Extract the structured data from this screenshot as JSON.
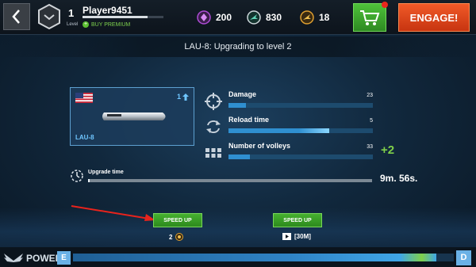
{
  "topbar": {
    "level": "1",
    "level_label": "Level",
    "player_name": "Player9451",
    "xp_progress": 0.8,
    "buy_premium": "BUY PREMIUM",
    "currencies": [
      {
        "name": "platinum",
        "icon": "diamond-icon",
        "color": "#b04cd8",
        "value": "200"
      },
      {
        "name": "credits",
        "icon": "plane-coin-icon",
        "color": "#3fb8a0",
        "value": "830"
      },
      {
        "name": "gold",
        "icon": "medal-coin-icon",
        "color": "#e0a030",
        "value": "18"
      }
    ],
    "engage_label": "ENGAGE!"
  },
  "subtitle": "LAU-8: Upgrading to level 2",
  "weapon": {
    "name": "LAU-8",
    "upgrades": "1",
    "flag": "us-flag-icon"
  },
  "stats": [
    {
      "label": "Damage",
      "value": "23",
      "progress": 0.12,
      "icon": "crosshair-icon"
    },
    {
      "label": "Reload time",
      "value": "5",
      "progress": 0.7,
      "icon": "reload-icon"
    },
    {
      "label": "Number of volleys",
      "value": "33",
      "progress": 0.15,
      "icon": "volleys-icon"
    }
  ],
  "volley_bonus": "+2",
  "upgrade_time": {
    "label": "Upgrade time",
    "remaining": "9m. 56s.",
    "progress": 0.005
  },
  "actions": [
    {
      "label": "SPEED UP",
      "cost": "2",
      "cost_icon": "gold-coin-icon"
    },
    {
      "label": "SPEED UP",
      "cost": "[30M]",
      "cost_icon": "video-ad-icon"
    }
  ],
  "power": {
    "label": "POWER",
    "start_grade": "E",
    "end_grade": "D",
    "progress": 0.955
  },
  "colors": {
    "accent_blue": "#2f8fd0",
    "engage_orange": "#e8481c",
    "cart_green": "#3fa82e",
    "bonus_green": "#7fd04a"
  }
}
